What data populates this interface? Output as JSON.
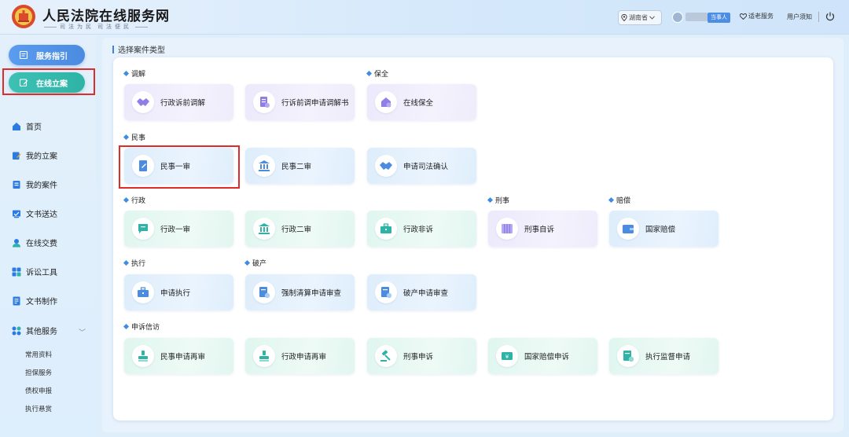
{
  "header": {
    "title": "人民法院在线服务网",
    "slogan_left": "司法为民",
    "slogan_right": "司法便民",
    "region": "湖南省",
    "role_badge": "当事人",
    "elder_service": "适老服务",
    "user_notice": "用户须知"
  },
  "sidebar": {
    "guide_button": "服务指引",
    "filing_button": "在线立案",
    "nav": [
      {
        "label": "首页",
        "icon": "home-icon"
      },
      {
        "label": "我的立案",
        "icon": "filing-edit-icon"
      },
      {
        "label": "我的案件",
        "icon": "case-file-icon"
      },
      {
        "label": "文书送达",
        "icon": "document-delivery-icon"
      },
      {
        "label": "在线交费",
        "icon": "payment-icon"
      },
      {
        "label": "诉讼工具",
        "icon": "tools-grid-icon"
      },
      {
        "label": "文书制作",
        "icon": "document-make-icon"
      },
      {
        "label": "其他服务",
        "icon": "apps-icon"
      }
    ],
    "sub_items": [
      "常用资料",
      "担保服务",
      "债权申报",
      "执行悬赏"
    ]
  },
  "main": {
    "heading": "选择案件类型",
    "groups": {
      "mediation": {
        "label": "调解",
        "tiles": [
          "行政诉前调解",
          "行诉前调申请调解书"
        ]
      },
      "preservation": {
        "label": "保全",
        "tiles": [
          "在线保全"
        ]
      },
      "civil": {
        "label": "民事",
        "tiles": [
          "民事一审",
          "民事二审",
          "申请司法确认"
        ]
      },
      "admin": {
        "label": "行政",
        "tiles": [
          "行政一审",
          "行政二审",
          "行政非诉"
        ]
      },
      "criminal": {
        "label": "刑事",
        "tiles": [
          "刑事自诉"
        ]
      },
      "compensation": {
        "label": "赔偿",
        "tiles": [
          "国家赔偿"
        ]
      },
      "execution": {
        "label": "执行",
        "tiles": [
          "申请执行"
        ]
      },
      "bankruptcy": {
        "label": "破产",
        "tiles": [
          "强制清算申请审查",
          "破产申请审查"
        ]
      },
      "petition": {
        "label": "申诉信访",
        "tiles": [
          "民事申请再审",
          "行政申请再审",
          "刑事申诉",
          "国家赔偿申诉",
          "执行监督申请"
        ]
      }
    }
  },
  "colors": {
    "accent_blue": "#4b8be0",
    "accent_teal": "#2fb3a7",
    "highlight_red": "#e02b2b",
    "role_badge": "#4c8de6"
  }
}
